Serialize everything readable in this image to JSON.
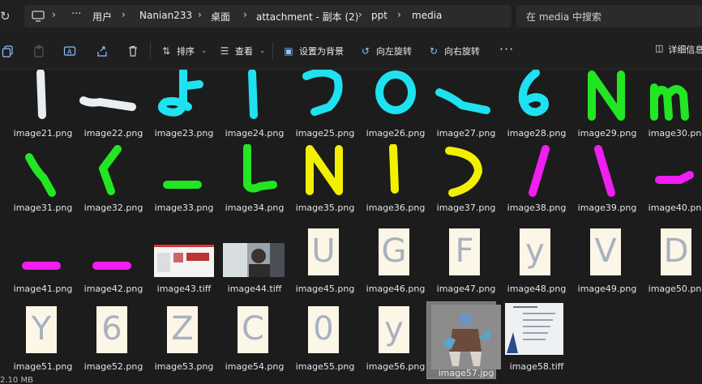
{
  "address": {
    "crumbs": [
      "用户",
      "Nanian233",
      "桌面",
      "attachment - 副本 (2)",
      "ppt",
      "media"
    ],
    "search_placeholder": "在 media 中搜索"
  },
  "toolbar": {
    "sort_label": "排序",
    "view_label": "查看",
    "set_bg_label": "设置为背景",
    "rotate_left_label": "向左旋转",
    "rotate_right_label": "向右旋转",
    "details_label": "详细信息"
  },
  "files": [
    {
      "name": "image21.png",
      "kind": "stroke",
      "color": "#e8eef2",
      "shape": "vbar"
    },
    {
      "name": "image22.png",
      "kind": "stroke",
      "color": "#e8eef2",
      "shape": "hook"
    },
    {
      "name": "image23.png",
      "kind": "stroke",
      "color": "#1fe1f0",
      "shape": "yo"
    },
    {
      "name": "image24.png",
      "kind": "stroke",
      "color": "#1fe1f0",
      "shape": "vbar"
    },
    {
      "name": "image25.png",
      "kind": "stroke",
      "color": "#1fe1f0",
      "shape": "seven"
    },
    {
      "name": "image26.png",
      "kind": "stroke",
      "color": "#1fe1f0",
      "shape": "circle"
    },
    {
      "name": "image27.png",
      "kind": "stroke",
      "color": "#1fe1f0",
      "shape": "dash"
    },
    {
      "name": "image28.png",
      "kind": "stroke",
      "color": "#1fe1f0",
      "shape": "six"
    },
    {
      "name": "image29.png",
      "kind": "stroke",
      "color": "#22e622",
      "shape": "N"
    },
    {
      "name": "image30.png",
      "kind": "stroke",
      "color": "#22e622",
      "shape": "m"
    },
    {
      "name": "image31.png",
      "kind": "stroke",
      "color": "#22e622",
      "shape": "slash"
    },
    {
      "name": "image32.png",
      "kind": "stroke",
      "color": "#22e622",
      "shape": "lt"
    },
    {
      "name": "image33.png",
      "kind": "stroke",
      "color": "#22e622",
      "shape": "low"
    },
    {
      "name": "image34.png",
      "kind": "stroke",
      "color": "#22e622",
      "shape": "L"
    },
    {
      "name": "image35.png",
      "kind": "stroke",
      "color": "#f2f000",
      "shape": "N"
    },
    {
      "name": "image36.png",
      "kind": "stroke",
      "color": "#f2f000",
      "shape": "vbar"
    },
    {
      "name": "image37.png",
      "kind": "stroke",
      "color": "#f2f000",
      "shape": "D"
    },
    {
      "name": "image38.png",
      "kind": "stroke",
      "color": "#f01ef0",
      "shape": "fslash"
    },
    {
      "name": "image39.png",
      "kind": "stroke",
      "color": "#f01ef0",
      "shape": "bslash"
    },
    {
      "name": "image40.png",
      "kind": "stroke",
      "color": "#f01ef0",
      "shape": "tick"
    },
    {
      "name": "image41.png",
      "kind": "stroke",
      "color": "#f01ef0",
      "shape": "low"
    },
    {
      "name": "image42.png",
      "kind": "stroke",
      "color": "#f01ef0",
      "shape": "low"
    },
    {
      "name": "image43.tiff",
      "kind": "screenshot"
    },
    {
      "name": "image44.tiff",
      "kind": "photo"
    },
    {
      "name": "image45.png",
      "kind": "letter",
      "char": "U"
    },
    {
      "name": "image46.png",
      "kind": "letter",
      "char": "G"
    },
    {
      "name": "image47.png",
      "kind": "letter",
      "char": "F"
    },
    {
      "name": "image48.png",
      "kind": "letter",
      "char": "y"
    },
    {
      "name": "image49.png",
      "kind": "letter",
      "char": "V"
    },
    {
      "name": "image50.png",
      "kind": "letter",
      "char": "D"
    },
    {
      "name": "image51.png",
      "kind": "letter",
      "char": "Y"
    },
    {
      "name": "image52.png",
      "kind": "letter",
      "char": "6"
    },
    {
      "name": "image53.png",
      "kind": "letter",
      "char": "Z"
    },
    {
      "name": "image54.png",
      "kind": "letter",
      "char": "C"
    },
    {
      "name": "image55.png",
      "kind": "letter",
      "char": "0"
    },
    {
      "name": "image56.png",
      "kind": "letter",
      "char": "y"
    },
    {
      "name": "image57.jpg",
      "kind": "character",
      "selected": true
    },
    {
      "name": "image58.tiff",
      "kind": "document"
    }
  ],
  "status": {
    "text": "2.10 MB"
  }
}
